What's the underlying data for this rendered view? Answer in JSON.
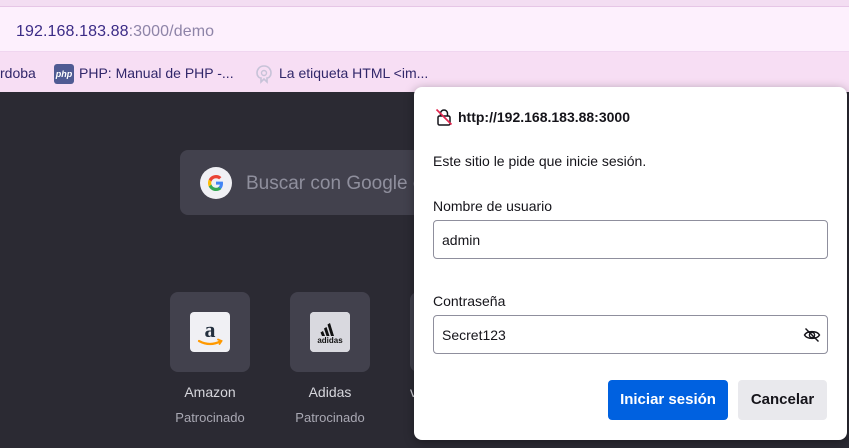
{
  "browser": {
    "url_host": "192.168.183.88",
    "url_rest": ":3000/demo",
    "bookmarks": [
      {
        "label": "rdoba"
      },
      {
        "label": "PHP: Manual de PHP -...",
        "icon": "php-icon",
        "icon_text": "php"
      },
      {
        "label": "La etiqueta HTML <im...",
        "icon": "html-icon"
      }
    ]
  },
  "newtab": {
    "search_placeholder": "Buscar con Google o",
    "tiles": [
      {
        "label": "Amazon",
        "sub": "Patrocinado",
        "icon": "amazon-icon"
      },
      {
        "label": "Adidas",
        "sub": "Patrocinado",
        "icon": "adidas-icon"
      }
    ],
    "partial_tile_label": "v"
  },
  "dialog": {
    "origin": "http://192.168.183.88:3000",
    "message": "Este sitio le pide que inicie sesión.",
    "username_label": "Nombre de usuario",
    "username_value": "admin",
    "password_label": "Contraseña",
    "password_value": "Secret123",
    "login_button": "Iniciar sesión",
    "cancel_button": "Cancelar",
    "primary_color": "#0061e0"
  }
}
